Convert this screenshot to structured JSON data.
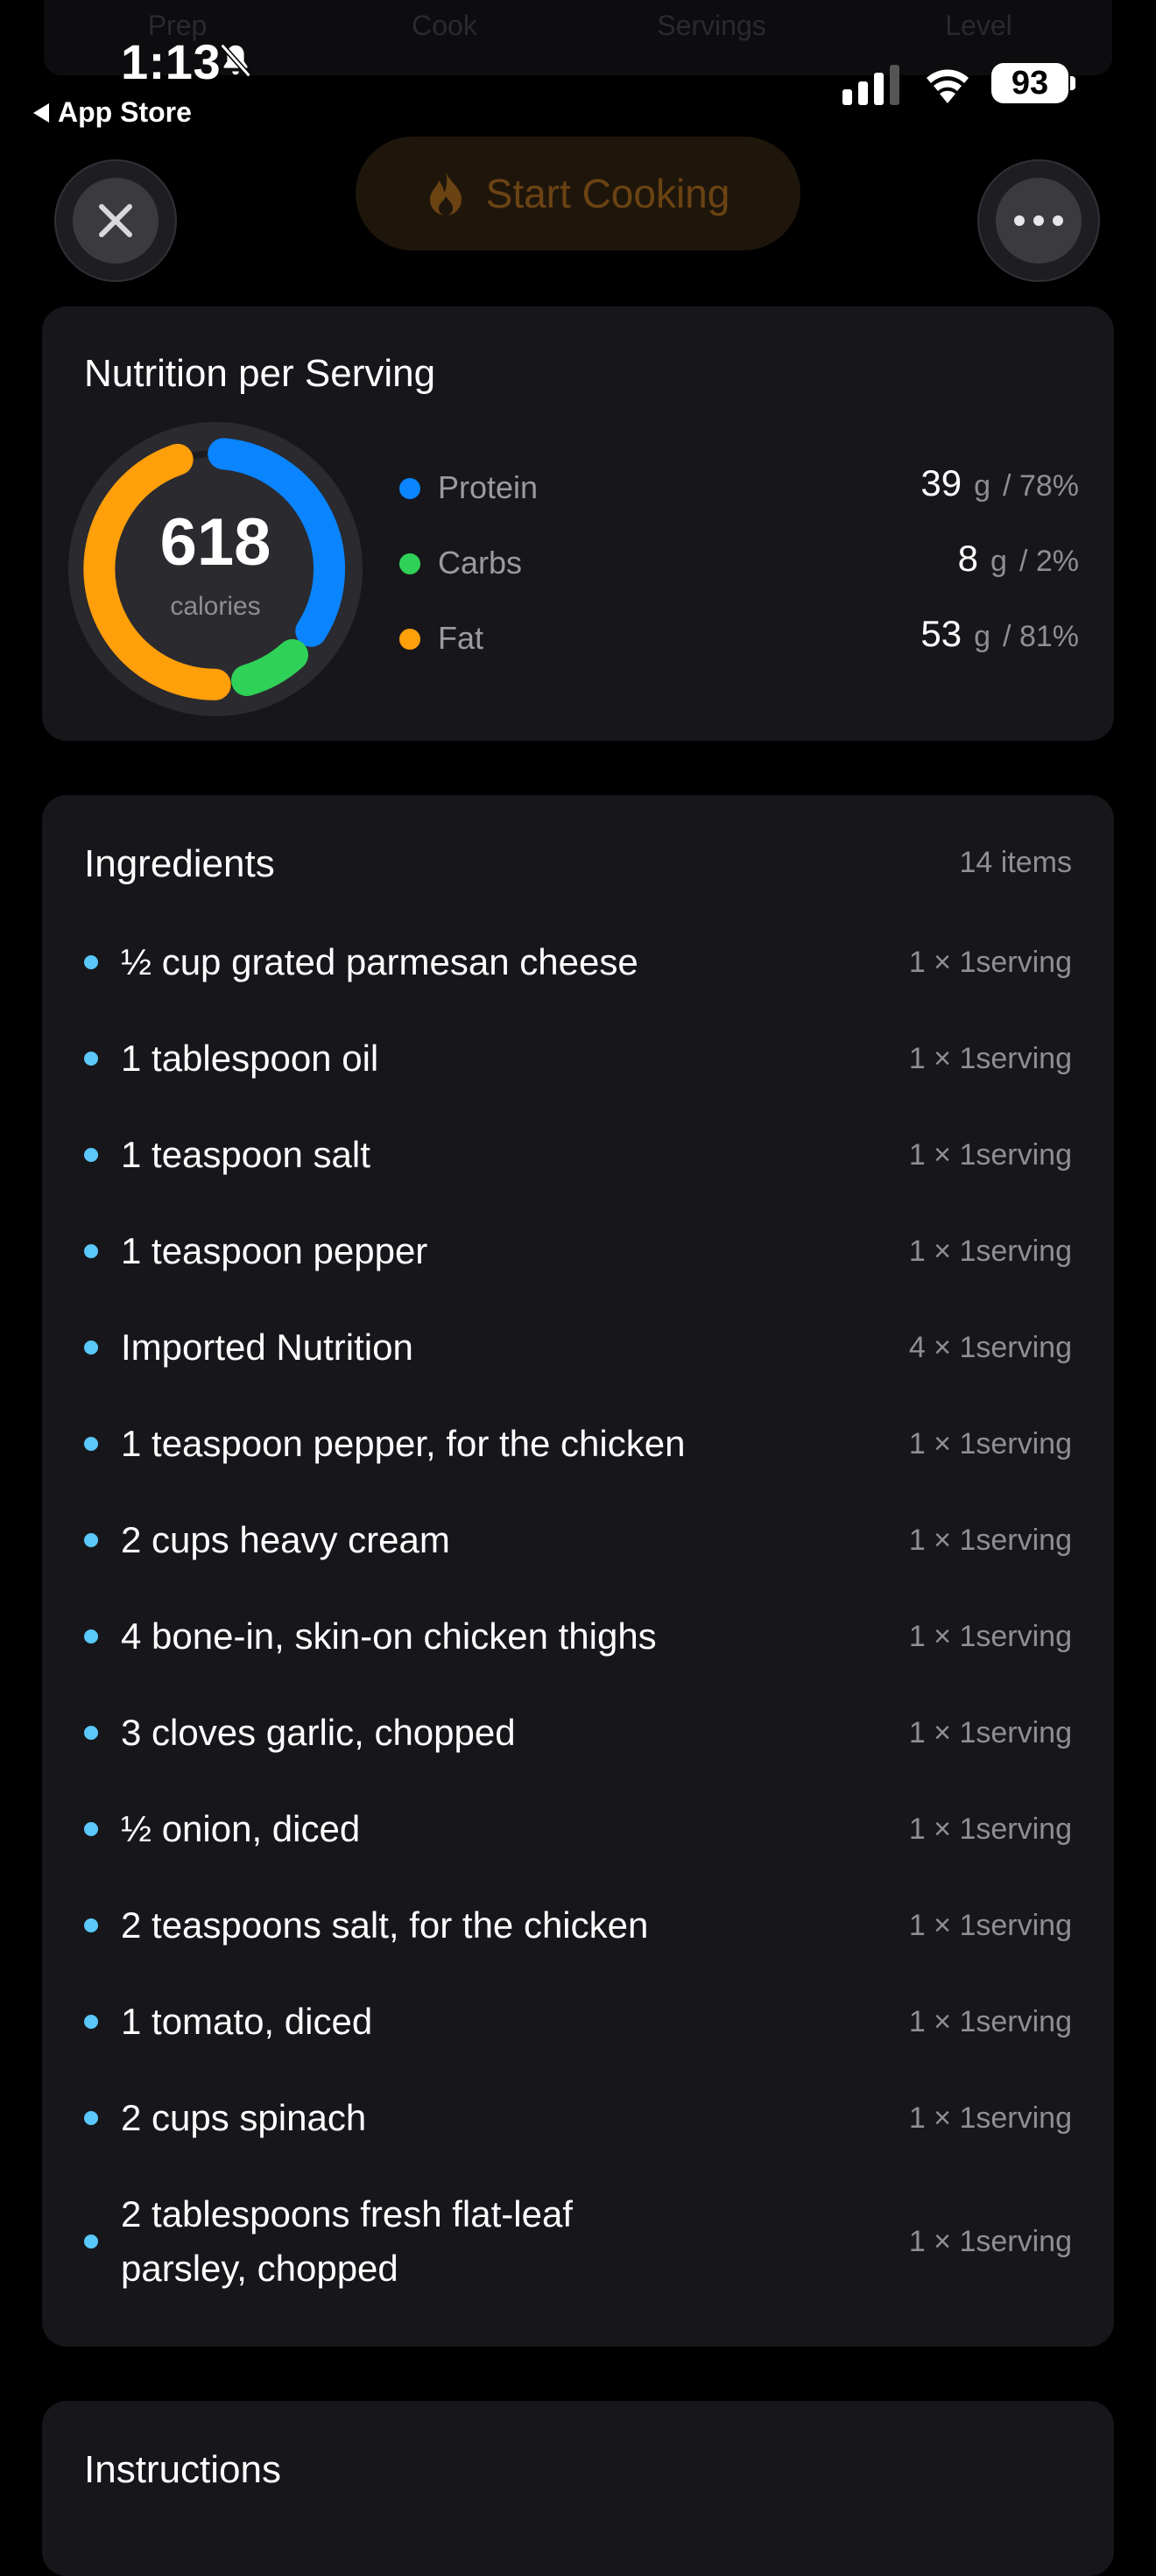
{
  "ghost_tabs": [
    "Prep",
    "Cook",
    "Servings",
    "Level"
  ],
  "status_bar": {
    "time": "1:13",
    "back_app": "App Store",
    "battery": "93"
  },
  "top_controls": {
    "start_label": "Start Cooking"
  },
  "nutrition": {
    "title": "Nutrition per Serving",
    "calories_value": "618",
    "calories_label": "calories",
    "macros": [
      {
        "name": "Protein",
        "value": "39",
        "unit": "g",
        "percent": "/ 78%",
        "color": "#0a84ff"
      },
      {
        "name": "Carbs",
        "value": "8",
        "unit": "g",
        "percent": "/ 2%",
        "color": "#30d158"
      },
      {
        "name": "Fat",
        "value": "53",
        "unit": "g",
        "percent": "/ 81%",
        "color": "#ff9f0a"
      }
    ]
  },
  "ingredients": {
    "title": "Ingredients",
    "count": "14 items",
    "items": [
      {
        "text": "½ cup grated parmesan cheese",
        "amount": "1 × 1serving"
      },
      {
        "text": "1 tablespoon oil",
        "amount": "1 × 1serving"
      },
      {
        "text": "1 teaspoon salt",
        "amount": "1 × 1serving"
      },
      {
        "text": "1 teaspoon pepper",
        "amount": "1 × 1serving"
      },
      {
        "text": "Imported Nutrition",
        "amount": "4 × 1serving"
      },
      {
        "text": "1 teaspoon pepper, for the chicken",
        "amount": "1 × 1serving"
      },
      {
        "text": "2 cups heavy cream",
        "amount": "1 × 1serving"
      },
      {
        "text": "4 bone-in, skin-on chicken thighs",
        "amount": "1 × 1serving"
      },
      {
        "text": "3 cloves garlic, chopped",
        "amount": "1 × 1serving"
      },
      {
        "text": "½ onion, diced",
        "amount": "1 × 1serving"
      },
      {
        "text": "2 teaspoons salt, for the chicken",
        "amount": "1 × 1serving"
      },
      {
        "text": "1 tomato, diced",
        "amount": "1 × 1serving"
      },
      {
        "text": "2 cups spinach",
        "amount": "1 × 1serving"
      },
      {
        "text": "2 tablespoons fresh flat-leaf parsley, chopped",
        "amount": "1 × 1serving"
      }
    ]
  },
  "instructions": {
    "title": "Instructions"
  }
}
